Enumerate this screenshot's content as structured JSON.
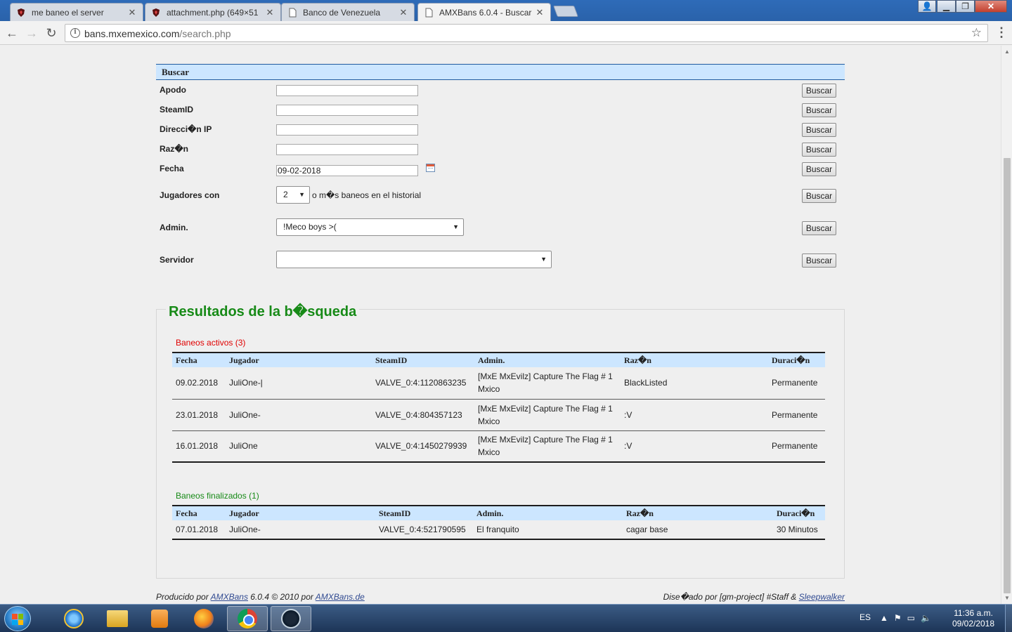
{
  "browser": {
    "tabs": [
      {
        "title": "me baneo el server",
        "icon": "shield-icon",
        "active": false
      },
      {
        "title": "attachment.php (649×51",
        "icon": "shield-icon",
        "active": false
      },
      {
        "title": "Banco de Venezuela",
        "icon": "page-icon",
        "active": false
      },
      {
        "title": "AMXBans 6.0.4 - Buscar",
        "icon": "page-icon",
        "active": true
      }
    ],
    "url_host": "bans.mxemexico.com",
    "url_path": "/search.php"
  },
  "search": {
    "header": "Buscar",
    "button_label": "Buscar",
    "fields": [
      {
        "label": "Apodo",
        "value": ""
      },
      {
        "label": "SteamID",
        "value": ""
      },
      {
        "label": "Direcci�n IP",
        "value": ""
      },
      {
        "label": "Raz�n",
        "value": ""
      },
      {
        "label": "Fecha",
        "value": "09-02-2018"
      }
    ],
    "players_with": {
      "label": "Jugadores con",
      "value": "2",
      "suffix": "o m�s baneos en el historial"
    },
    "admin": {
      "label": "Admin.",
      "value": "!Meco boys >("
    },
    "server": {
      "label": "Servidor",
      "value": ""
    }
  },
  "results": {
    "title": "Resultados de la b�squeda",
    "active": {
      "title": "Baneos activos (3)",
      "columns": [
        "Fecha",
        "Jugador",
        "SteamID",
        "Admin.",
        "Raz�n",
        "Duraci�n"
      ],
      "rows": [
        [
          "09.02.2018",
          "JuliOne-|",
          "VALVE_0:4:1120863235",
          "[MxE MxEvilz] Capture The Flag # 1 Mxico",
          "BlackListed",
          "Permanente"
        ],
        [
          "23.01.2018",
          "JuliOne-",
          "VALVE_0:4:804357123",
          "[MxE MxEvilz] Capture The Flag # 1 Mxico",
          ":V",
          "Permanente"
        ],
        [
          "16.01.2018",
          "JuliOne",
          "VALVE_0:4:1450279939",
          "[MxE MxEvilz] Capture The Flag # 1 Mxico",
          ":V",
          "Permanente"
        ]
      ]
    },
    "finished": {
      "title": "Baneos finalizados (1)",
      "columns": [
        "Fecha",
        "Jugador",
        "SteamID",
        "Admin.",
        "Raz�n",
        "Duraci�n"
      ],
      "rows": [
        [
          "07.01.2018",
          "JuliOne-",
          "VALVE_0:4:521790595",
          "El franquito",
          "cagar base",
          "30 Minutos"
        ]
      ]
    }
  },
  "footer": {
    "left_prefix": "Producido por ",
    "left_link1": "AMXBans",
    "left_middle": " 6.0.4 © 2010 por ",
    "left_link2": "AMXBans.de",
    "right_prefix": "Dise�ado por [gm-project] #Staff & ",
    "right_link": "Sleepwalker"
  },
  "taskbar": {
    "language": "ES",
    "time": "11:36 a.m.",
    "date": "09/02/2018",
    "apps": [
      "ie-icon",
      "explorer-icon",
      "media-player-icon",
      "firefox-icon",
      "chrome-icon",
      "steam-icon"
    ]
  },
  "colors": {
    "header_bg": "#cce6ff",
    "results_title": "#178a17",
    "active_bans": "#e00000",
    "finished_bans": "#178a17",
    "link": "#304a91"
  }
}
